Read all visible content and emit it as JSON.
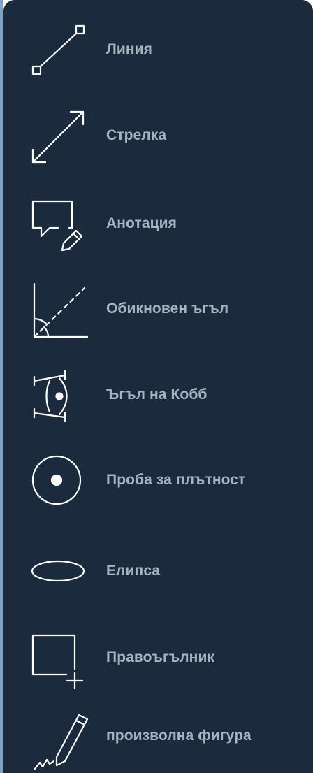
{
  "panel": {
    "background": "#1c2a3d",
    "text_color": "#a9b3bf",
    "icon_color": "#ffffff"
  },
  "tools": [
    {
      "label": "Линия",
      "icon": "line-icon"
    },
    {
      "label": "Стрелка",
      "icon": "arrow-icon"
    },
    {
      "label": "Анотация",
      "icon": "annotation-icon"
    },
    {
      "label": "Обикновен ъгъл",
      "icon": "angle-icon"
    },
    {
      "label": "Ъгъл на Кобб",
      "icon": "cobb-angle-icon"
    },
    {
      "label": "Проба за плътност",
      "icon": "density-probe-icon"
    },
    {
      "label": "Елипса",
      "icon": "ellipse-icon"
    },
    {
      "label": "Правоъгълник",
      "icon": "rectangle-icon"
    },
    {
      "label": "произволна фигура",
      "icon": "freehand-icon"
    }
  ]
}
